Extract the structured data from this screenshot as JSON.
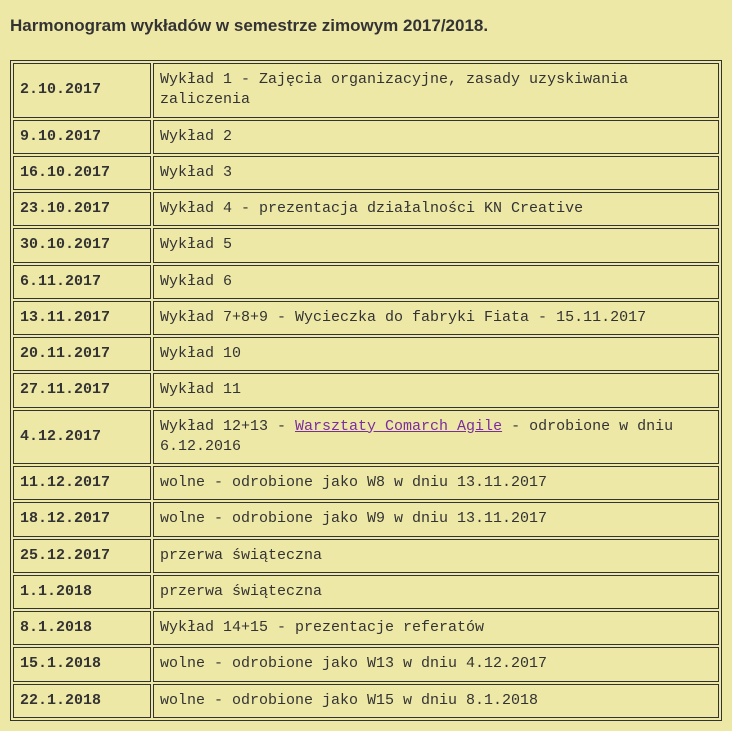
{
  "title": "Harmonogram wykładów w semestrze zimowym 2017/2018.",
  "rows": [
    {
      "date": "2.10.2017",
      "segments": [
        {
          "t": "Wykład 1 - Zajęcia organizacyjne, zasady uzyskiwania zaliczenia"
        }
      ]
    },
    {
      "date": "9.10.2017",
      "segments": [
        {
          "t": "Wykład 2"
        }
      ]
    },
    {
      "date": "16.10.2017",
      "segments": [
        {
          "t": "Wykład 3"
        }
      ]
    },
    {
      "date": "23.10.2017",
      "segments": [
        {
          "t": "Wykład 4 - prezentacja działalności KN Creative"
        }
      ]
    },
    {
      "date": "30.10.2017",
      "segments": [
        {
          "t": "Wykład 5"
        }
      ]
    },
    {
      "date": "6.11.2017",
      "segments": [
        {
          "t": "Wykład 6"
        }
      ]
    },
    {
      "date": "13.11.2017",
      "segments": [
        {
          "t": "Wykład 7+8+9 - Wycieczka do fabryki Fiata - 15.11.2017"
        }
      ]
    },
    {
      "date": "20.11.2017",
      "segments": [
        {
          "t": "Wykład 10"
        }
      ]
    },
    {
      "date": "27.11.2017",
      "segments": [
        {
          "t": "Wykład 11"
        }
      ]
    },
    {
      "date": "4.12.2017",
      "segments": [
        {
          "t": "Wykład 12+13 - "
        },
        {
          "t": "Warsztaty Comarch Agile",
          "link": true
        },
        {
          "t": " - odrobione w dniu 6.12.2016"
        }
      ]
    },
    {
      "date": "11.12.2017",
      "segments": [
        {
          "t": "wolne - odrobione jako W8 w dniu 13.11.2017"
        }
      ]
    },
    {
      "date": "18.12.2017",
      "segments": [
        {
          "t": "wolne - odrobione jako W9 w dniu 13.11.2017"
        }
      ]
    },
    {
      "date": "25.12.2017",
      "segments": [
        {
          "t": "przerwa świąteczna"
        }
      ]
    },
    {
      "date": "1.1.2018",
      "segments": [
        {
          "t": "przerwa świąteczna"
        }
      ]
    },
    {
      "date": "8.1.2018",
      "segments": [
        {
          "t": "Wykład 14+15 - prezentacje referatów"
        }
      ]
    },
    {
      "date": "15.1.2018",
      "segments": [
        {
          "t": "wolne - odrobione jako W13 w dniu 4.12.2017"
        }
      ]
    },
    {
      "date": "22.1.2018",
      "segments": [
        {
          "t": "wolne - odrobione jako W15 w dniu 8.1.2018"
        }
      ]
    }
  ]
}
